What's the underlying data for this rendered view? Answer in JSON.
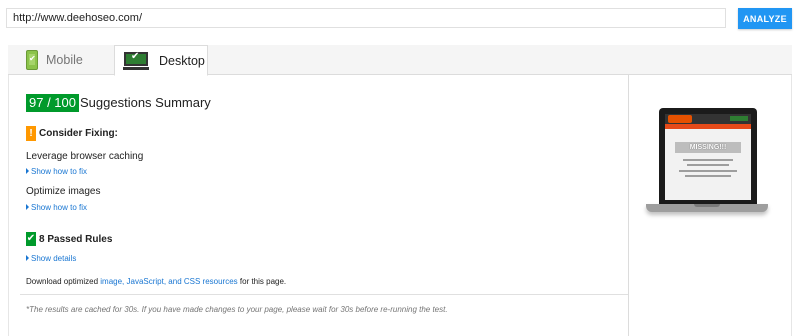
{
  "url_bar": {
    "value": "http://www.deehoseo.com/"
  },
  "analyze_label": "ANALYZE",
  "tabs": [
    {
      "label": "Mobile",
      "icon": "mobile-phone-check-icon",
      "active": false
    },
    {
      "label": "Desktop",
      "icon": "desktop-monitor-check-icon",
      "active": true
    }
  ],
  "score": "97 / 100",
  "summary_title": "Suggestions Summary",
  "consider": {
    "badge": "!",
    "title": "Consider Fixing:"
  },
  "rules": [
    {
      "title": "Leverage browser caching",
      "link": "Show how to fix"
    },
    {
      "title": "Optimize images",
      "link": "Show how to fix"
    }
  ],
  "passed": {
    "badge": "✔",
    "title": "8 Passed Rules",
    "link": "Show details"
  },
  "download": {
    "prefix": "Download optimized ",
    "link": "image, JavaScript, and CSS resources",
    "suffix": " for this page."
  },
  "footnote": "*The results are cached for 30s. If you have made changes to your page, please wait for 30s before re-running the test.",
  "preview": {
    "banner_text": "MISSING!!!"
  },
  "colors": {
    "accent": "#2196f3",
    "score_bg": "#009a2b",
    "warn": "#ff9800",
    "link": "#1976d2"
  }
}
